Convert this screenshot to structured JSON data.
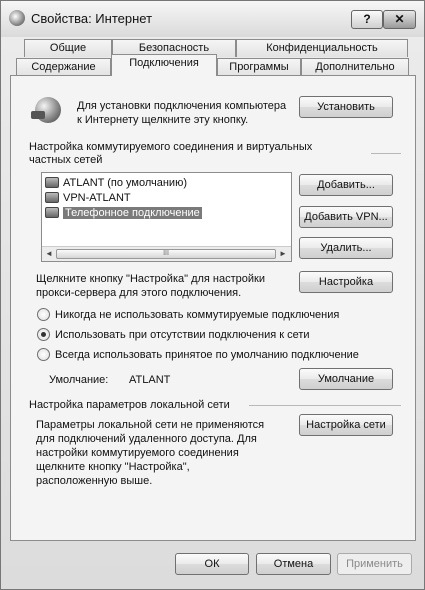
{
  "window": {
    "title": "Свойства: Интернет",
    "help_btn": "?",
    "close_btn": "✕"
  },
  "tabs_top": [
    "Общие",
    "Безопасность",
    "Конфиденциальность"
  ],
  "tabs_bottom": [
    "Содержание",
    "Подключения",
    "Программы",
    "Дополнительно"
  ],
  "active_tab": "Подключения",
  "setup": {
    "text_line1": "Для установки подключения компьютера",
    "text_line2": "к Интернету щелкните эту кнопку.",
    "button": "Установить"
  },
  "dialup": {
    "heading_line1": "Настройка коммутируемого соединения и виртуальных",
    "heading_line2": "частных сетей",
    "connections": [
      {
        "label": "ATLANT (по умолчанию)",
        "selected": false
      },
      {
        "label": "VPN-ATLANT",
        "selected": false
      },
      {
        "label": "Телефонное подключение",
        "selected": true
      }
    ],
    "scroll_left": "◄",
    "scroll_right": "►",
    "scroll_grip": "III",
    "add_button": "Добавить...",
    "add_vpn_button": "Добавить VPN...",
    "remove_button": "Удалить...",
    "proxy_text_line1": "Щелкните кнопку \"Настройка\" для настройки",
    "proxy_text_line2": "прокси-сервера для этого подключения.",
    "settings_button": "Настройка",
    "options": [
      {
        "label": "Никогда не использовать коммутируемые подключения",
        "checked": false
      },
      {
        "label": "Использовать при отсутствии подключения к сети",
        "checked": true
      },
      {
        "label": "Всегда использовать принятое по умолчанию подключение",
        "checked": false
      }
    ],
    "default_label": "Умолчание:",
    "default_value": "ATLANT",
    "default_button": "Умолчание"
  },
  "lan": {
    "heading": "Настройка параметров локальной сети",
    "text": [
      "Параметры локальной сети не применяются",
      "для подключений удаленного доступа. Для",
      "настройки коммутируемого соединения",
      "щелкните кнопку \"Настройка\",",
      "расположенную выше."
    ],
    "button": "Настройка сети"
  },
  "footer": {
    "ok": "ОК",
    "cancel": "Отмена",
    "apply": "Применить"
  }
}
